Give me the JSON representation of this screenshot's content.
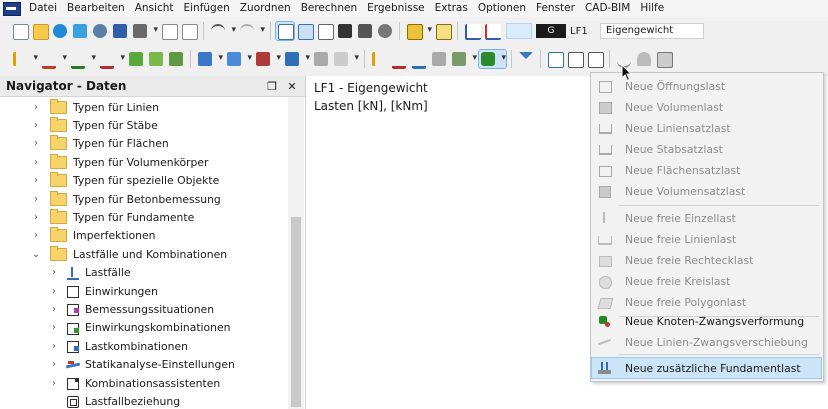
{
  "menubar": {
    "items": [
      "Datei",
      "Bearbeiten",
      "Ansicht",
      "Einfügen",
      "Zuordnen",
      "Berechnen",
      "Ergebnisse",
      "Extras",
      "Optionen",
      "Fenster",
      "CAD-BIM",
      "Hilfe"
    ]
  },
  "toolbar": {
    "loadcase_tag": "G",
    "loadcase_id": "LF1",
    "loadcase_name": "Eigengewicht"
  },
  "navigator": {
    "title": "Navigator - Daten",
    "items": [
      {
        "label": "Typen für Linien",
        "level": 1,
        "icon": "folder-icon",
        "expander": "collapsed"
      },
      {
        "label": "Typen für Stäbe",
        "level": 1,
        "icon": "folder-icon",
        "expander": "collapsed"
      },
      {
        "label": "Typen für Flächen",
        "level": 1,
        "icon": "folder-icon",
        "expander": "collapsed"
      },
      {
        "label": "Typen für Volumenkörper",
        "level": 1,
        "icon": "folder-icon",
        "expander": "collapsed"
      },
      {
        "label": "Typen für spezielle Objekte",
        "level": 1,
        "icon": "folder-icon",
        "expander": "collapsed"
      },
      {
        "label": "Typen für Betonbemessung",
        "level": 1,
        "icon": "folder-icon",
        "expander": "collapsed"
      },
      {
        "label": "Typen für Fundamente",
        "level": 1,
        "icon": "folder-icon",
        "expander": "collapsed"
      },
      {
        "label": "Imperfektionen",
        "level": 1,
        "icon": "folder-icon",
        "expander": "collapsed"
      },
      {
        "label": "Lastfälle und Kombinationen",
        "level": 1,
        "icon": "folder-icon",
        "expander": "expanded"
      },
      {
        "label": "Lastfälle",
        "level": 2,
        "icon": "load-case-icon",
        "expander": "collapsed"
      },
      {
        "label": "Einwirkungen",
        "level": 2,
        "icon": "actions-icon",
        "expander": "collapsed"
      },
      {
        "label": "Bemessungssituationen",
        "level": 2,
        "icon": "design-situations-icon",
        "expander": "collapsed"
      },
      {
        "label": "Einwirkungskombinationen",
        "level": 2,
        "icon": "action-combinations-icon",
        "expander": "collapsed"
      },
      {
        "label": "Lastkombinationen",
        "level": 2,
        "icon": "load-combinations-icon",
        "expander": "collapsed"
      },
      {
        "label": "Statikanalyse-Einstellungen",
        "level": 2,
        "icon": "static-analysis-icon",
        "expander": "collapsed"
      },
      {
        "label": "Kombinationsassistenten",
        "level": 2,
        "icon": "combination-wizard-icon",
        "expander": "collapsed"
      },
      {
        "label": "Lastfallbeziehung",
        "level": 2,
        "icon": "load-case-relation-icon",
        "expander": "none"
      }
    ]
  },
  "main": {
    "line1": "LF1 - Eigengewicht",
    "line2": "Lasten [kN], [kNm]"
  },
  "dropdown": {
    "items": [
      {
        "label": "Neue Öffnungslast",
        "enabled": false,
        "icon": "opening-load-icon"
      },
      {
        "label": "Neue Volumenlast",
        "enabled": false,
        "icon": "solid-load-icon"
      },
      {
        "label": "Neue Liniensatzlast",
        "enabled": false,
        "icon": "line-set-load-icon"
      },
      {
        "label": "Neue Stabsatzlast",
        "enabled": false,
        "icon": "member-set-load-icon"
      },
      {
        "label": "Neue Flächensatzlast",
        "enabled": false,
        "icon": "surface-set-load-icon"
      },
      {
        "label": "Neue Volumensatzlast",
        "enabled": false,
        "icon": "solid-set-load-icon"
      },
      {
        "label": "Neue freie Einzellast",
        "enabled": false,
        "icon": "free-concentrated-load-icon"
      },
      {
        "label": "Neue freie Linienlast",
        "enabled": false,
        "icon": "free-line-load-icon"
      },
      {
        "label": "Neue freie Rechtecklast",
        "enabled": false,
        "icon": "free-rectangular-load-icon"
      },
      {
        "label": "Neue freie Kreislast",
        "enabled": false,
        "icon": "free-circular-load-icon"
      },
      {
        "label": "Neue freie Polygonlast",
        "enabled": false,
        "icon": "free-polygon-load-icon"
      },
      {
        "label": "Neue Knoten-Zwangsverformung",
        "enabled": true,
        "icon": "nodal-imposed-deformation-icon"
      },
      {
        "label": "Neue Linien-Zwangsverschiebung",
        "enabled": false,
        "icon": "line-imposed-displacement-icon"
      },
      {
        "label": "Neue zusätzliche Fundamentlast",
        "enabled": true,
        "active": true,
        "icon": "additional-foundation-load-icon"
      }
    ]
  }
}
